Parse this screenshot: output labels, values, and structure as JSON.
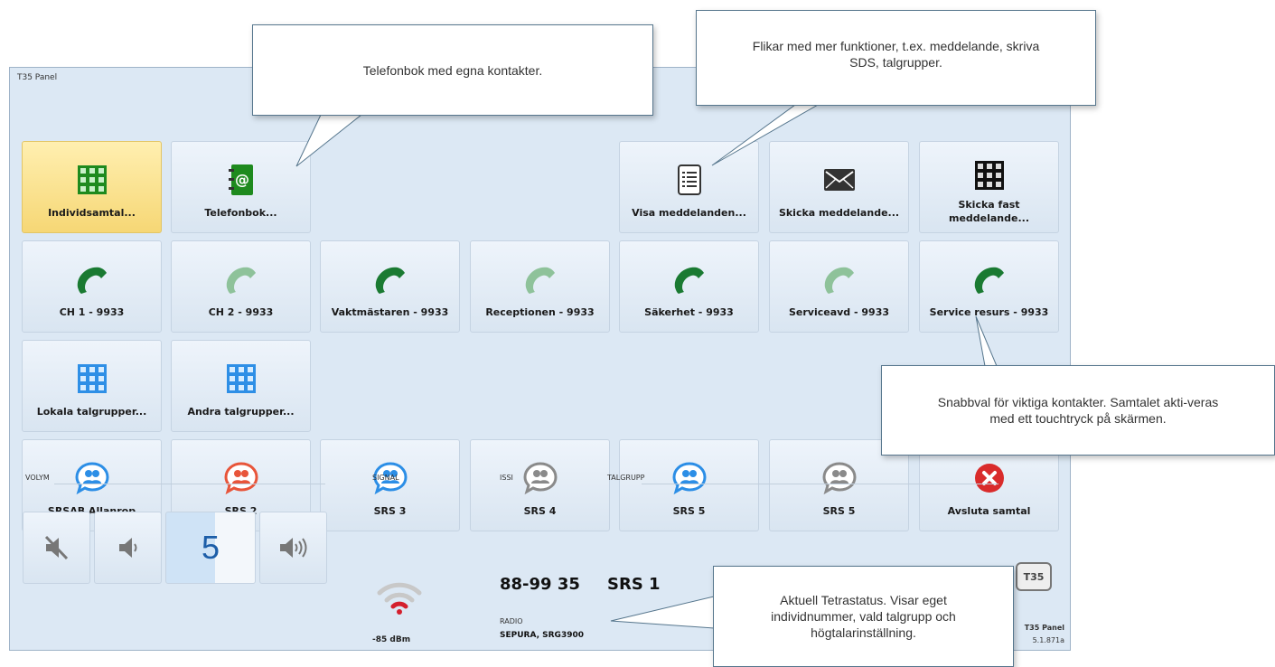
{
  "window": {
    "title": "T35 Panel"
  },
  "top_buttons": [
    {
      "label": "Individsamtal...",
      "icon": "keypad-icon"
    },
    {
      "label": "Telefonbok...",
      "icon": "phonebook-icon"
    },
    {
      "label": "Visa meddelanden...",
      "icon": "message-list-icon"
    },
    {
      "label": "Skicka meddelande...",
      "icon": "envelope-icon"
    },
    {
      "label": "Skicka fast meddelande...",
      "icon": "keypad-icon"
    }
  ],
  "contacts": [
    {
      "label": "CH 1 - 9933",
      "state": "active"
    },
    {
      "label": "CH 2 - 9933",
      "state": "inactive"
    },
    {
      "label": "Vaktmästaren - 9933",
      "state": "active"
    },
    {
      "label": "Receptionen - 9933",
      "state": "inactive"
    },
    {
      "label": "Säkerhet - 9933",
      "state": "active"
    },
    {
      "label": "Serviceavd - 9933",
      "state": "inactive"
    },
    {
      "label": "Service resurs - 9933",
      "state": "active"
    }
  ],
  "group_buttons": [
    {
      "label": "Lokala talgrupper..."
    },
    {
      "label": "Andra talgrupper..."
    }
  ],
  "talkgroups": [
    {
      "label": "SRSAB Allanrop",
      "color": "#2c8ee6"
    },
    {
      "label": "SRS 2",
      "color": "#e8553a"
    },
    {
      "label": "SRS 3",
      "color": "#2c8ee6"
    },
    {
      "label": "SRS 4",
      "color": "#8a8a8a"
    },
    {
      "label": "SRS 5",
      "color": "#2c8ee6"
    },
    {
      "label": "SRS 5",
      "color": "#8a8a8a"
    }
  ],
  "end_call": {
    "label": "Avsluta samtal"
  },
  "status": {
    "volym_label": "VOLYM",
    "volume_value": "5",
    "signal_label": "SIGNAL",
    "signal_value": "-85 dBm",
    "issi_label": "ISSI",
    "issi_value": "88-99 35",
    "talgrupp_label": "TALGRUPP",
    "talgrupp_value": "SRS 1",
    "radio_label": "RADIO",
    "radio_value": "SEPURA, SRG3900",
    "app_name": "T35 Panel",
    "version": "5.1.871a",
    "logo_text": "T35"
  },
  "callouts": {
    "phonebook": "Telefonbok med egna kontakter.",
    "tabs": "Flikar med mer funktioner, t.ex. meddelande, skriva SDS, talgrupper.",
    "quickdial": "Snabbval för viktiga kontakter. Samtalet akti-veras med ett touchtryck på skärmen.",
    "status": "Aktuell Tetrastatus. Visar eget individnummer, vald talgrupp och högtalarinställning."
  }
}
